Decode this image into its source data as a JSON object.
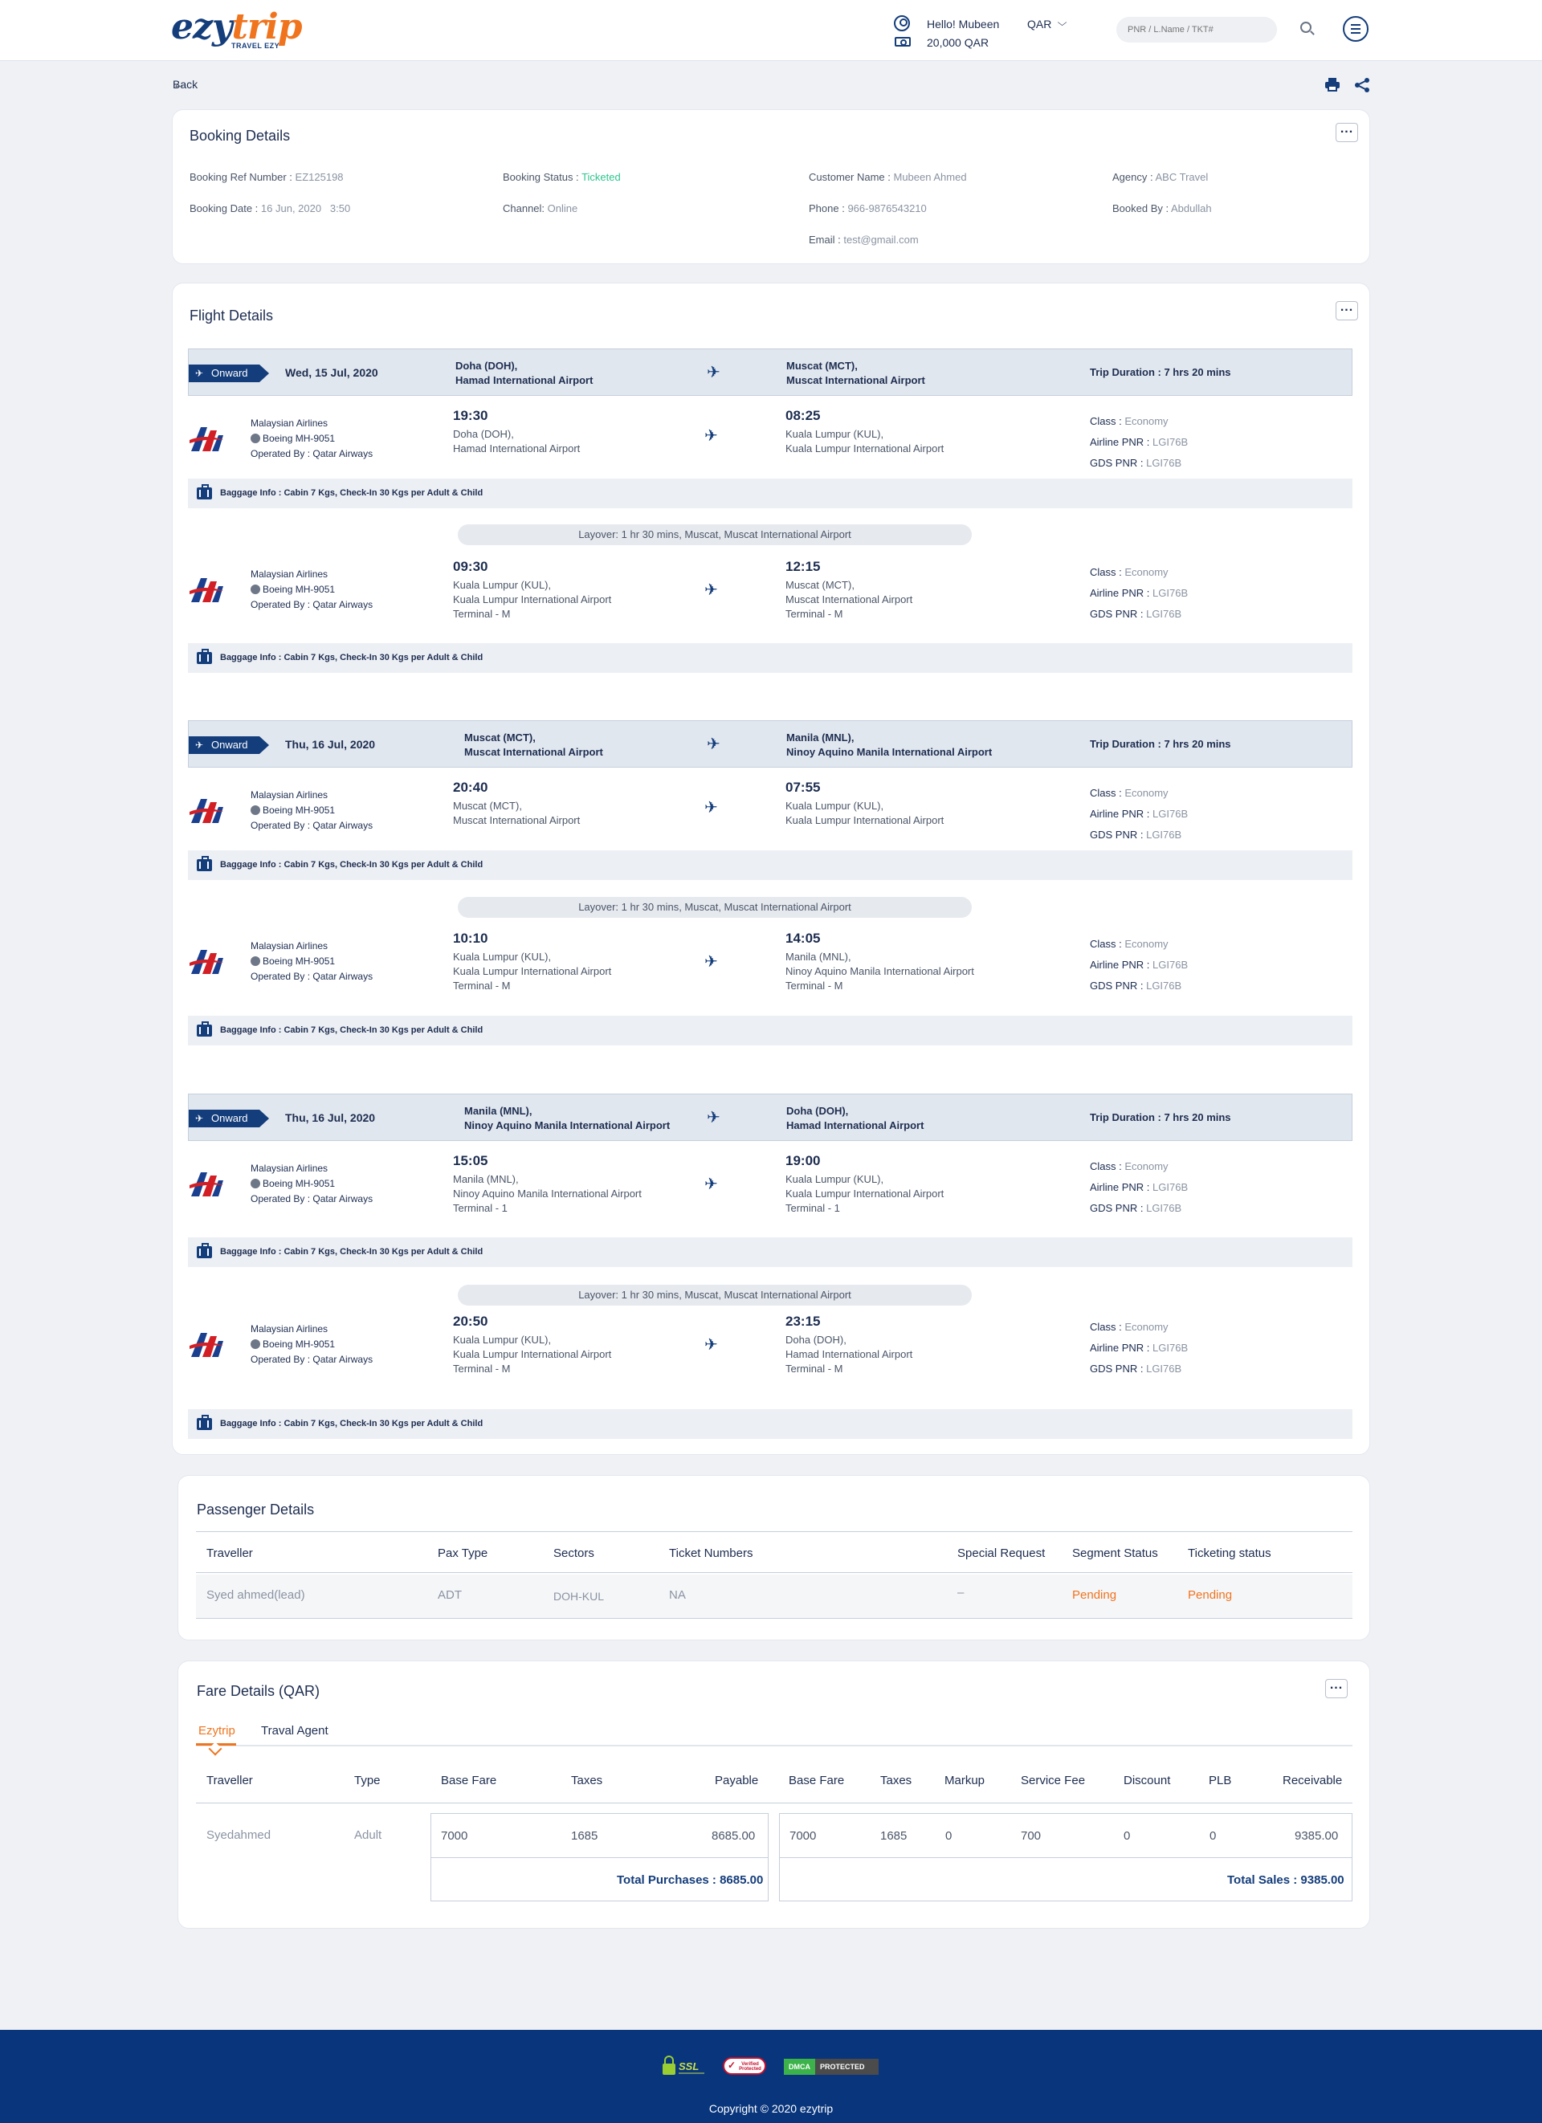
{
  "header": {
    "logo": {
      "ezy": "ezy",
      "trip": "trip",
      "tagline": "TRAVEL EZY"
    },
    "greeting": "Hello! Mubeen",
    "balance": "20,000 QAR",
    "currency": "QAR",
    "search_placeholder": "PNR / L.Name / TKT#",
    "icons": [
      "user-icon",
      "wallet-icon",
      "chevron-down-icon",
      "search-icon",
      "menu-icon"
    ]
  },
  "nav": {
    "back_label": "Back"
  },
  "booking": {
    "title": "Booking Details",
    "ref_label": "Booking Ref Number :",
    "ref": "EZ125198",
    "status_label": "Booking Status :",
    "status": "Ticketed",
    "customer_label": "Customer Name :",
    "customer": "Mubeen Ahmed",
    "agency_label": "Agency :",
    "agency": "ABC Travel",
    "date_label": "Booking Date :",
    "date": "16 Jun, 2020   3:50",
    "channel_label": "Channel:",
    "channel": "Online",
    "phone_label": "Phone :",
    "phone": "966-9876543210",
    "booked_by_label": "Booked By :",
    "booked_by": "Abdullah",
    "email_label": "Email :",
    "email": "test@gmail.com",
    "colors": {
      "status": "#2dc58f"
    }
  },
  "flight": {
    "title": "Flight Details",
    "segments": [
      {
        "tag": "Onward",
        "date": "Wed, 15 Jul, 2020",
        "from_line1": "Doha (DOH),",
        "from_line2": "Hamad International Airport",
        "to_line1": "Muscat (MCT),",
        "to_line2": "Muscat International Airport",
        "duration": "Trip Duration : 7 hrs 20 mins",
        "legs": [
          {
            "airline": "Malaysian Airlines",
            "aircraft": "Boeing MH-9051",
            "operated": "Operated By : Qatar Airways",
            "dep_time": "19:30",
            "dep_city": "Doha (DOH),",
            "dep_airport": "Hamad International Airport",
            "dep_terminal": "",
            "arr_time": "08:25",
            "arr_city": "Kuala Lumpur (KUL),",
            "arr_airport": "Kuala Lumpur International Airport",
            "arr_terminal": "",
            "class": "Economy",
            "airline_pnr": "LGI76B",
            "gds_pnr": "LGI76B",
            "baggage": "Baggage Info : Cabin 7 Kgs, Check-In 30 Kgs per Adult & Child"
          },
          {
            "airline": "Malaysian Airlines",
            "aircraft": "Boeing MH-9051",
            "operated": "Operated By : Qatar Airways",
            "dep_time": "09:30",
            "dep_city": "Kuala Lumpur (KUL),",
            "dep_airport": "Kuala Lumpur International Airport",
            "dep_terminal": "Terminal - M",
            "arr_time": "12:15",
            "arr_city": "Muscat (MCT),",
            "arr_airport": "Muscat International Airport",
            "arr_terminal": "Terminal - M",
            "class": "Economy",
            "airline_pnr": "LGI76B",
            "gds_pnr": "LGI76B",
            "baggage": "Baggage Info : Cabin 7 Kgs, Check-In 30 Kgs per Adult & Child"
          }
        ],
        "layover": "Layover: 1 hr 30 mins, Muscat, Muscat International Airport"
      },
      {
        "tag": "Onward",
        "date": "Thu, 16 Jul, 2020",
        "from_line1": "Muscat (MCT),",
        "from_line2": "Muscat International Airport",
        "to_line1": "Manila (MNL),",
        "to_line2": "Ninoy Aquino Manila International Airport",
        "duration": "Trip Duration : 7 hrs 20 mins",
        "legs": [
          {
            "airline": "Malaysian Airlines",
            "aircraft": "Boeing MH-9051",
            "operated": "Operated By : Qatar Airways",
            "dep_time": "20:40",
            "dep_city": "Muscat (MCT),",
            "dep_airport": "Muscat International Airport",
            "dep_terminal": "",
            "arr_time": "07:55",
            "arr_city": "Kuala Lumpur (KUL),",
            "arr_airport": "Kuala Lumpur International Airport",
            "arr_terminal": "",
            "class": "Economy",
            "airline_pnr": "LGI76B",
            "gds_pnr": "LGI76B",
            "baggage": "Baggage Info : Cabin 7 Kgs, Check-In 30 Kgs per Adult & Child"
          },
          {
            "airline": "Malaysian Airlines",
            "aircraft": "Boeing MH-9051",
            "operated": "Operated By : Qatar Airways",
            "dep_time": "10:10",
            "dep_city": "Kuala Lumpur (KUL),",
            "dep_airport": "Kuala Lumpur International Airport",
            "dep_terminal": "Terminal - M",
            "arr_time": "14:05",
            "arr_city": "Manila (MNL),",
            "arr_airport": "Ninoy Aquino Manila International Airport",
            "arr_terminal": "Terminal - M",
            "class": "Economy",
            "airline_pnr": "LGI76B",
            "gds_pnr": "LGI76B",
            "baggage": "Baggage Info : Cabin 7 Kgs, Check-In 30 Kgs per Adult & Child"
          }
        ],
        "layover": "Layover: 1 hr 30 mins, Muscat, Muscat International Airport"
      },
      {
        "tag": "Onward",
        "date": "Thu, 16 Jul, 2020",
        "from_line1": "Manila (MNL),",
        "from_line2": "Ninoy Aquino Manila International Airport",
        "to_line1": "Doha (DOH),",
        "to_line2": "Hamad International Airport",
        "duration": "Trip Duration : 7 hrs 20 mins",
        "legs": [
          {
            "airline": "Malaysian Airlines",
            "aircraft": "Boeing MH-9051",
            "operated": "Operated By : Qatar Airways",
            "dep_time": "15:05",
            "dep_city": "Manila (MNL),",
            "dep_airport": "Ninoy Aquino Manila International Airport",
            "dep_terminal": "Terminal - 1",
            "arr_time": "19:00",
            "arr_city": "Kuala Lumpur (KUL),",
            "arr_airport": "Kuala Lumpur International Airport",
            "arr_terminal": "Terminal - 1",
            "class": "Economy",
            "airline_pnr": "LGI76B",
            "gds_pnr": "LGI76B",
            "baggage": "Baggage Info : Cabin 7 Kgs, Check-In 30 Kgs per Adult & Child"
          },
          {
            "airline": "Malaysian Airlines",
            "aircraft": "Boeing MH-9051",
            "operated": "Operated By : Qatar Airways",
            "dep_time": "20:50",
            "dep_city": "Kuala Lumpur (KUL),",
            "dep_airport": "Kuala Lumpur International Airport",
            "dep_terminal": "Terminal - M",
            "arr_time": "23:15",
            "arr_city": "Doha (DOH),",
            "arr_airport": "Hamad International Airport",
            "arr_terminal": "Terminal - M",
            "class": "Economy",
            "airline_pnr": "LGI76B",
            "gds_pnr": "LGI76B",
            "baggage": "Baggage Info : Cabin 7 Kgs, Check-In 30 Kgs per Adult & Child"
          }
        ],
        "layover": "Layover: 1 hr 30 mins, Muscat, Muscat International Airport"
      }
    ],
    "labels": {
      "class": "Class :",
      "airline_pnr": "Airline PNR :",
      "gds_pnr": "GDS PNR :"
    }
  },
  "passengers": {
    "title": "Passenger Details",
    "columns": [
      "Traveller",
      "Pax Type",
      "Sectors",
      "Ticket Numbers",
      "Special Request",
      "Segment Status",
      "Ticketing status"
    ],
    "rows": [
      [
        "Syed ahmed(lead)",
        "ADT",
        "DOH-KUL",
        "NA",
        "–",
        "Pending",
        "Pending"
      ]
    ],
    "colors": {
      "pending": "#f0741e"
    }
  },
  "fare": {
    "title": "Fare Details (QAR)",
    "tabs": [
      "Ezytrip",
      "Traval Agent"
    ],
    "active_tab": "Ezytrip",
    "columns": [
      "Traveller",
      "Type",
      "Base Fare",
      "Taxes",
      "Payable",
      "Base Fare",
      "Taxes",
      "Markup",
      "Service Fee",
      "Discount",
      "PLB",
      "Receivable"
    ],
    "row": {
      "traveller": "Syedahmed",
      "type": "Adult",
      "base": "7000",
      "taxes": "1685",
      "payable": "8685.00",
      "base2": "7000",
      "taxes2": "1685",
      "markup": "0",
      "service_fee": "700",
      "discount": "0",
      "plb": "0",
      "receivable": "9385.00"
    },
    "total_purchases": "Total Purchases : 8685.00",
    "total_sales": "Total Sales : 9385.00"
  },
  "footer": {
    "badges": {
      "ssl": "SSL",
      "verified": "Verified Protected",
      "dmca": "DMCA",
      "protected": "PROTECTED"
    },
    "copyright": "Copyright © 2020 ezytrip"
  },
  "theme": {
    "primary": "#143d7b",
    "accent": "#f0741e",
    "footer": "#08357c"
  }
}
